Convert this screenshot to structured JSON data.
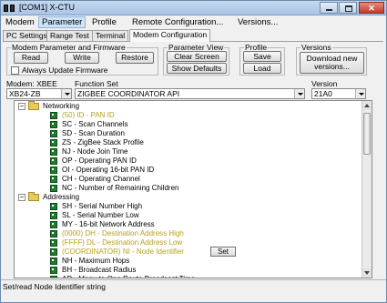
{
  "window": {
    "title": "[COM1] X-CTU"
  },
  "menu": {
    "items": [
      "Modem",
      "Parameter",
      "Profile",
      "Remote Configuration...",
      "Versions..."
    ]
  },
  "tabs": [
    "PC Settings",
    "Range Test",
    "Terminal",
    "Modem Configuration"
  ],
  "modem_params_group": {
    "label": "Modem Parameter and Firmware",
    "read": "Read",
    "write": "Write",
    "restore": "Restore",
    "always_update": "Always Update Firmware"
  },
  "param_view_group": {
    "label": "Parameter View",
    "clear_screen": "Clear Screen",
    "show_defaults": "Show Defaults"
  },
  "profile_group": {
    "label": "Profile",
    "save": "Save",
    "load": "Load"
  },
  "versions_group": {
    "label": "Versions",
    "download_line1": "Download new",
    "download_line2": "versions..."
  },
  "selectors": {
    "modem_label": "Modem: XBEE",
    "modem_value": "XB24-ZB",
    "function_label": "Function Set",
    "function_value": "ZIGBEE COORDINATOR API",
    "version_label": "Version",
    "version_value": "21A0"
  },
  "tree": {
    "set_button": "Set",
    "rows": [
      {
        "text": "Networking"
      },
      {
        "text": "(50) ID - PAN ID"
      },
      {
        "text": "SC - Scan Channels"
      },
      {
        "text": "SD - Scan Duration"
      },
      {
        "text": "ZS - ZigBee Stack Profile"
      },
      {
        "text": "NJ - Node Join Time"
      },
      {
        "text": "OP - Operating PAN ID"
      },
      {
        "text": "OI - Operating 16-bit PAN ID"
      },
      {
        "text": "CH - Operating Channel"
      },
      {
        "text": "NC - Number of Remaining Children"
      },
      {
        "text": "Addressing"
      },
      {
        "text": "SH - Serial Number High"
      },
      {
        "text": "SL - Serial Number Low"
      },
      {
        "text": "MY - 16-bit Network Address"
      },
      {
        "text": "(0000) DH - Destination Address High"
      },
      {
        "text": "(FFFF) DL - Destination Address Low"
      },
      {
        "text": "(COORDINATOR) NI - Node Identifier"
      },
      {
        "text": "NH - Maximum Hops"
      },
      {
        "text": "BH - Broadcast Radius"
      },
      {
        "text": "AR - Many-to-One Route Broadcast Time"
      }
    ]
  },
  "status": {
    "text": "Set/read Node Identifier string"
  },
  "colors": {
    "changed_value": "#b5a21c",
    "param_icon": "#1d7d2e",
    "folder": "#e9c85c"
  }
}
